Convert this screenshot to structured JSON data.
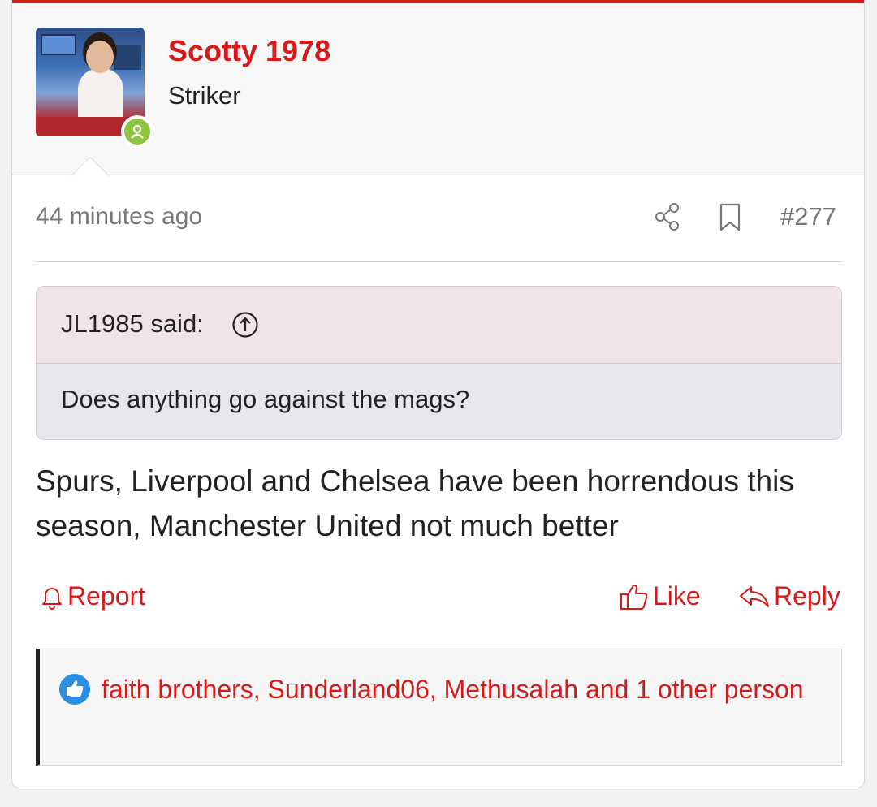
{
  "post": {
    "author": "Scotty 1978",
    "author_title": "Striker",
    "timestamp": "44 minutes ago",
    "post_number": "#277",
    "body": "Spurs, Liverpool and Chelsea have been horrendous this season, Manchester United not much better"
  },
  "quote": {
    "attribution": "JL1985 said:",
    "text": "Does anything go against the mags?"
  },
  "actions": {
    "report": "Report",
    "like": "Like",
    "reply": "Reply"
  },
  "reactions": {
    "text": "faith brothers, Sunderland06, Methusalah and 1 other person"
  },
  "icons": {
    "share": "share-icon",
    "bookmark": "bookmark-icon",
    "quote_jump": "arrow-up-circle-icon",
    "report": "bell-icon",
    "like": "thumbs-up-icon",
    "reply": "reply-arrow-icon",
    "reaction": "like-reaction-icon",
    "online": "online-user-icon"
  },
  "colors": {
    "accent": "#d61a1a",
    "online": "#8cc63e",
    "reaction": "#2a8fe0",
    "quote_header": "#f0e4e6",
    "quote_body": "#e5e7ea"
  }
}
